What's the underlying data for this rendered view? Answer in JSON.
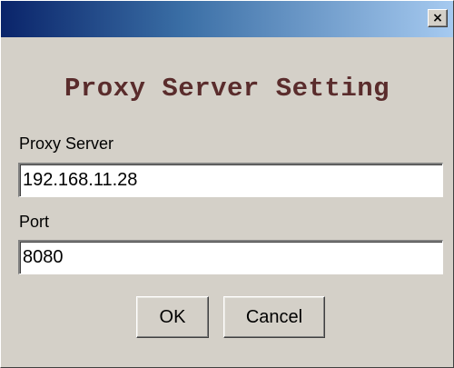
{
  "window": {
    "close_symbol": "×",
    "close_icon": "close-icon"
  },
  "dialog": {
    "heading": "Proxy Server Setting",
    "proxy_server": {
      "label": "Proxy Server",
      "value": "192.168.11.28"
    },
    "port": {
      "label": "Port",
      "value": "8080"
    },
    "ok_label": "OK",
    "cancel_label": "Cancel"
  },
  "colors": {
    "titlebar_start": "#0a246a",
    "titlebar_end": "#a6caf0",
    "background": "#d4d0c8",
    "heading": "#5a2c2c"
  }
}
